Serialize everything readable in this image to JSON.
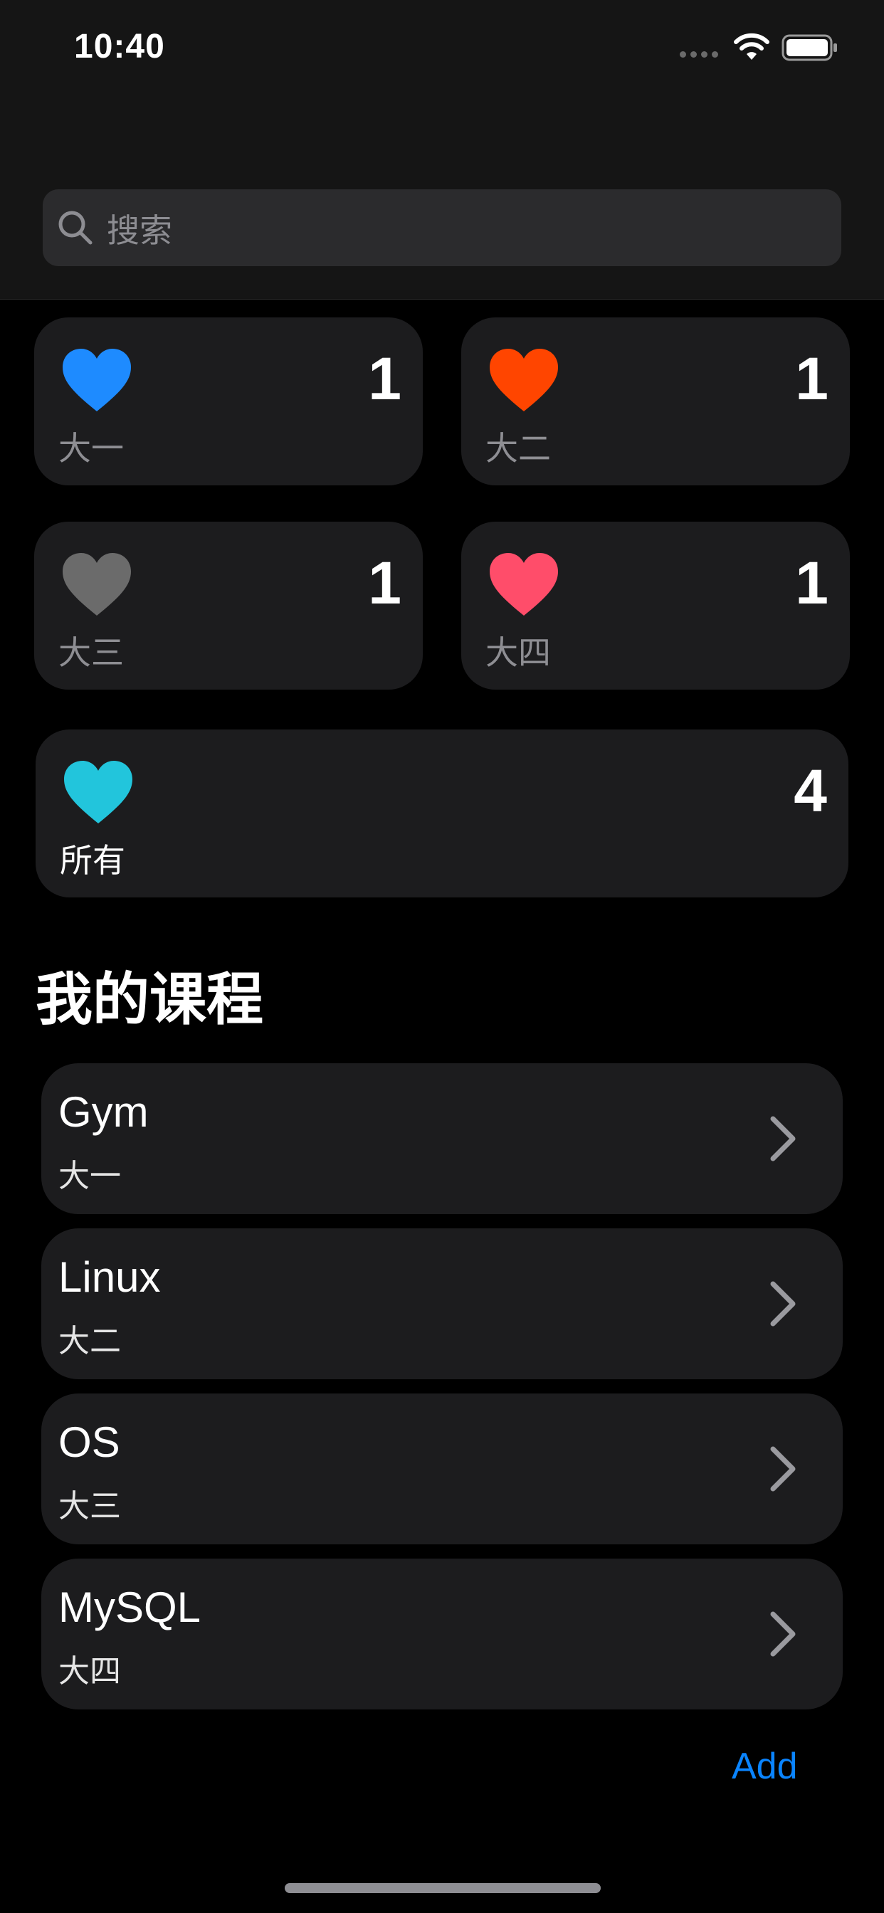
{
  "status_bar": {
    "time": "10:40",
    "wifi_icon": "wifi-icon",
    "battery_icon": "battery-icon"
  },
  "search": {
    "placeholder": "搜索",
    "icon": "search-icon"
  },
  "summary_tiles": [
    {
      "label": "大一",
      "count": "1",
      "color": "#1e8bff",
      "icon": "heart-icon"
    },
    {
      "label": "大二",
      "count": "1",
      "color": "#ff4500",
      "icon": "heart-icon"
    },
    {
      "label": "大三",
      "count": "1",
      "color": "#6b6b6b",
      "icon": "heart-icon"
    },
    {
      "label": "大四",
      "count": "1",
      "color": "#ff4d6a",
      "icon": "heart-icon"
    },
    {
      "label": "所有",
      "count": "4",
      "color": "#22c5dc",
      "icon": "heart-icon"
    }
  ],
  "courses": {
    "title": "我的课程",
    "items": [
      {
        "name": "Gym",
        "year": "大一"
      },
      {
        "name": "Linux",
        "year": "大二"
      },
      {
        "name": "OS",
        "year": "大三"
      },
      {
        "name": "MySQL",
        "year": "大四"
      }
    ]
  },
  "add_label": "Add",
  "colors": {
    "background": "#000000",
    "card": "#1c1c1e",
    "accent": "#0a84ff"
  }
}
